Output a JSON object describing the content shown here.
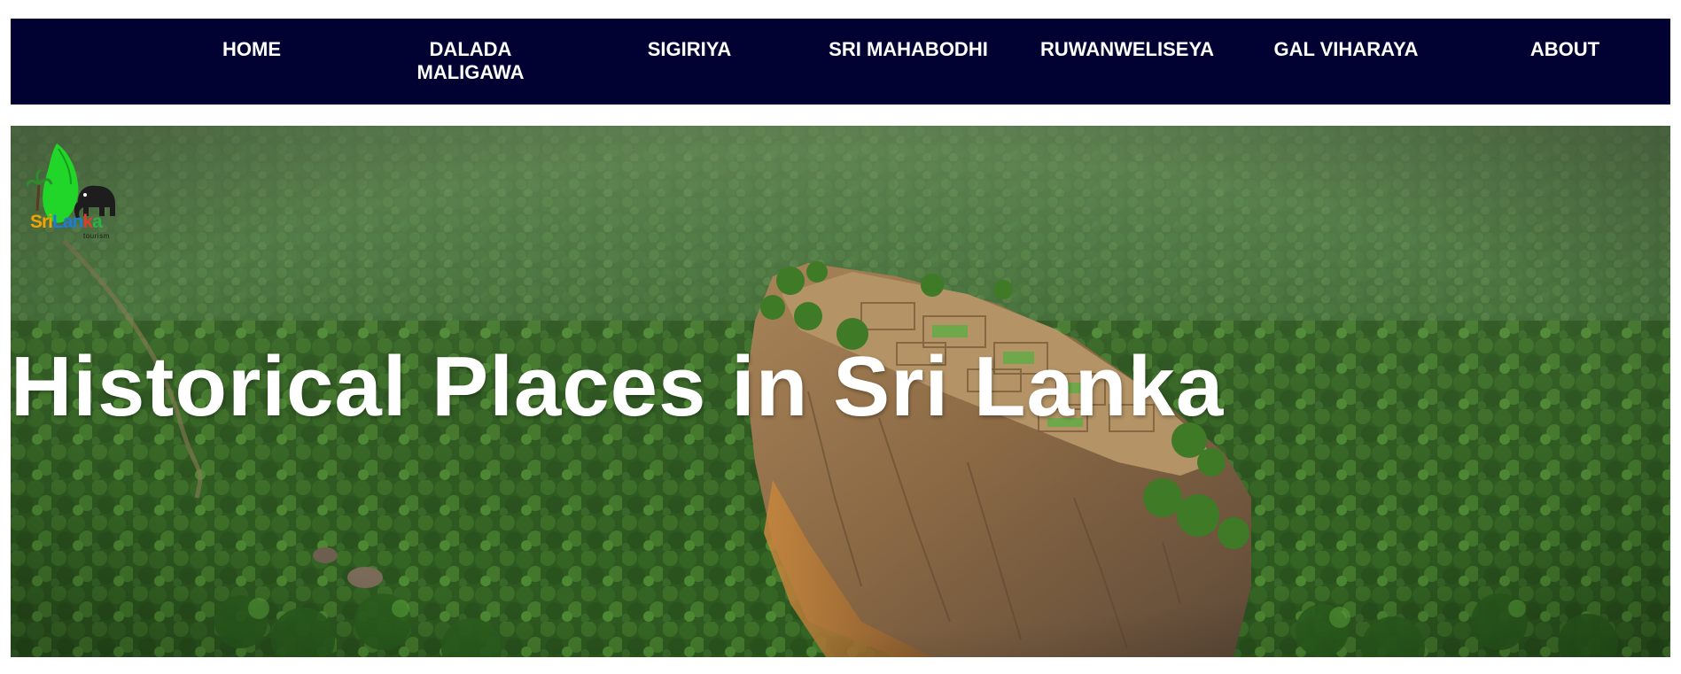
{
  "nav": {
    "items": [
      {
        "label_lines": [
          "HOME"
        ]
      },
      {
        "label_lines": [
          "DALADA",
          "MALIGAWA"
        ]
      },
      {
        "label_lines": [
          "SIGIRIYA"
        ]
      },
      {
        "label_lines": [
          "SRI MAHABODHI"
        ]
      },
      {
        "label_lines": [
          "RUWANWELISEYA"
        ]
      },
      {
        "label_lines": [
          "GAL VIHARAYA"
        ]
      },
      {
        "label_lines": [
          "ABOUT"
        ]
      }
    ]
  },
  "hero": {
    "title": "Historical Places in Sri Lanka",
    "image_subject": "aerial view of Sigiriya rock fortress over forest"
  },
  "logo": {
    "text_parts": [
      "Sri",
      "Lan",
      "k",
      "a"
    ],
    "sub": "tourism",
    "icons": [
      "sri-lanka-map-icon",
      "elephant-icon",
      "palm-tree-icon"
    ]
  },
  "colors": {
    "navbar_bg": "#010132",
    "nav_text": "#ffffff",
    "hero_title": "#ffffff",
    "map_green": "#22d629"
  }
}
